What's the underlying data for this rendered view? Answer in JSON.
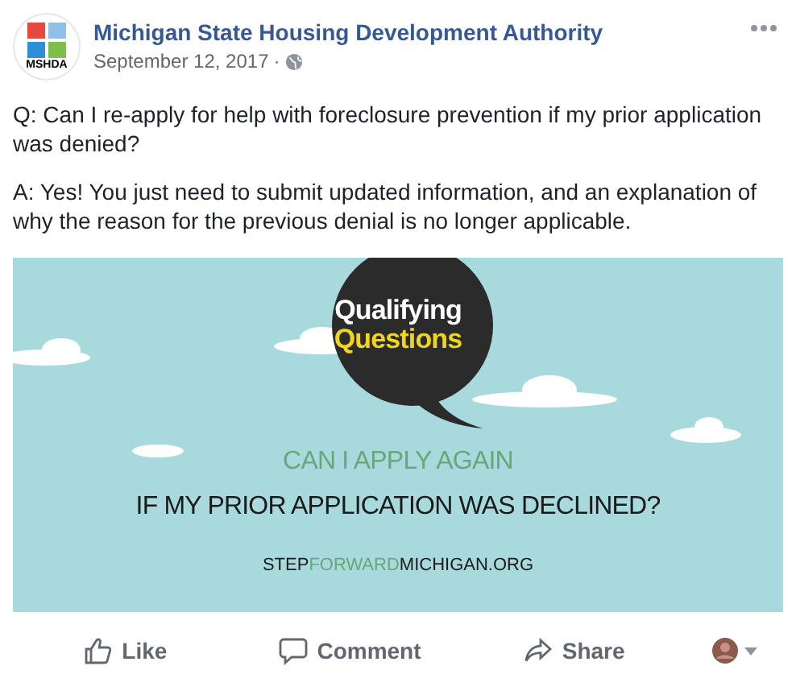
{
  "post": {
    "author": "Michigan State Housing Development Authority",
    "avatar_label": "MSHDA",
    "date": "September 12, 2017",
    "separator": "·",
    "paragraphs": [
      "Q: Can I re-apply for help with foreclosure prevention if my prior application was denied?",
      "A: Yes! You just need to submit updated information, and an explanation of why the reason for the previous denial is no longer applicable."
    ]
  },
  "image": {
    "bubble_lines": [
      "Qualifying",
      "Questions"
    ],
    "headline_1": "CAN I APPLY AGAIN",
    "headline_2": "IF MY PRIOR APPLICATION WAS DECLINED?",
    "url_parts": [
      {
        "text": "STEP",
        "color": "#1a1a1a"
      },
      {
        "text": "FORWARD",
        "color": "#6aa67a"
      },
      {
        "text": "MICHIGAN.ORG",
        "color": "#1a1a1a"
      }
    ]
  },
  "actions": [
    {
      "label": "Like",
      "kind": "like"
    },
    {
      "label": "Comment",
      "kind": "comment"
    },
    {
      "label": "Share",
      "kind": "share"
    }
  ]
}
